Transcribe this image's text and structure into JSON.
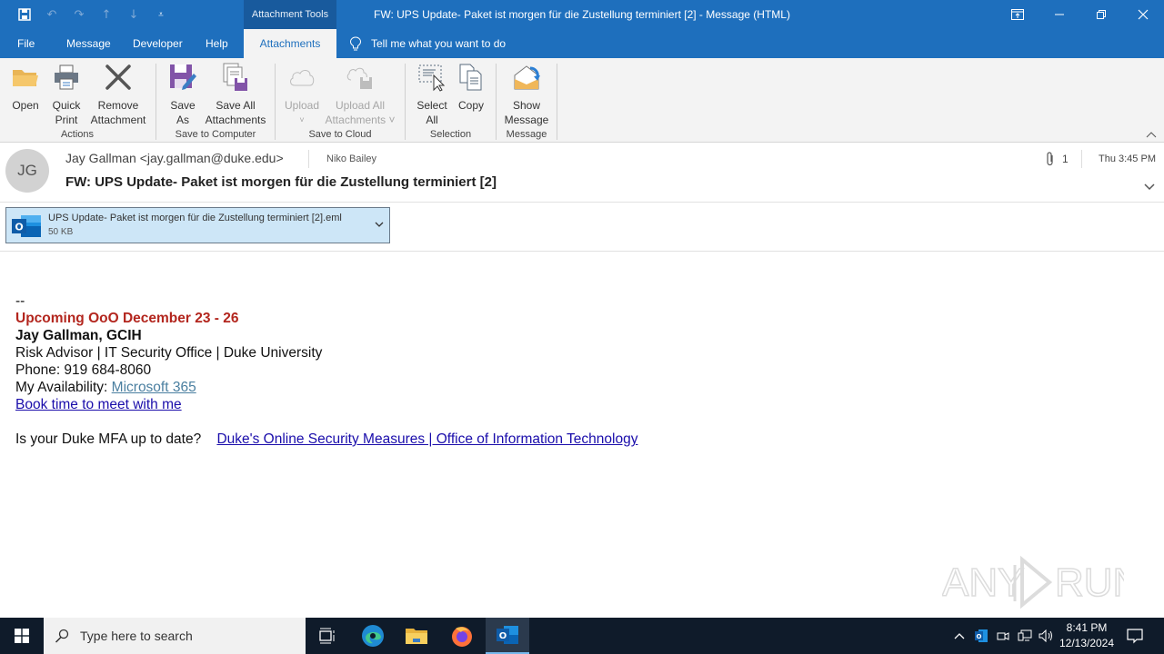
{
  "titlebar": {
    "context_tools": "Attachment Tools",
    "window_title": "FW: UPS Update- Paket ist morgen für die Zustellung terminiert [2]  -  Message (HTML)"
  },
  "tabs": [
    {
      "label": "File"
    },
    {
      "label": "Message"
    },
    {
      "label": "Developer"
    },
    {
      "label": "Help"
    },
    {
      "label": "Attachments",
      "active": true
    }
  ],
  "tell_me": "Tell me what you want to do",
  "ribbon": {
    "groups": [
      {
        "label": "Actions",
        "buttons": [
          {
            "label1": "Open",
            "label2": ""
          },
          {
            "label1": "Quick",
            "label2": "Print"
          },
          {
            "label1": "Remove",
            "label2": "Attachment"
          }
        ]
      },
      {
        "label": "Save to Computer",
        "buttons": [
          {
            "label1": "Save",
            "label2": "As"
          },
          {
            "label1": "Save All",
            "label2": "Attachments"
          }
        ]
      },
      {
        "label": "Save to Cloud",
        "buttons": [
          {
            "label1": "Upload",
            "label2": "˅",
            "disabled": true
          },
          {
            "label1": "Upload All",
            "label2": "Attachments ˅",
            "disabled": true
          }
        ]
      },
      {
        "label": "Selection",
        "buttons": [
          {
            "label1": "Select",
            "label2": "All"
          },
          {
            "label1": "Copy",
            "label2": ""
          }
        ]
      },
      {
        "label": "Message",
        "buttons": [
          {
            "label1": "Show",
            "label2": "Message"
          }
        ]
      }
    ]
  },
  "message": {
    "avatar_initials": "JG",
    "sender": "Jay Gallman <jay.gallman@duke.edu>",
    "recipient": "Niko Bailey",
    "subject": "FW: UPS Update- Paket ist morgen für die Zustellung terminiert [2]",
    "attachment_count": "1",
    "time": "Thu 3:45 PM"
  },
  "attachment": {
    "name": "UPS Update- Paket ist morgen für die Zustellung terminiert [2].eml",
    "size": "50 KB"
  },
  "body": {
    "separator": "--",
    "ooo": "Upcoming OoO December 23 - 26",
    "name": "Jay Gallman, GCIH",
    "title": "Risk Advisor | IT Security Office | Duke University",
    "phone": "Phone: 919 684-8060",
    "availability_label": "My Availability: ",
    "availability_link": "Microsoft 365",
    "book_link": "Book time to meet with me",
    "mfa_question": "Is your Duke MFA up to date?",
    "mfa_link": "Duke's Online Security Measures | Office of Information Technology"
  },
  "watermark": "ANY RUN",
  "taskbar": {
    "search_placeholder": "Type here to search",
    "clock_time": "8:41 PM",
    "clock_date": "12/13/2024"
  },
  "colors": {
    "accent": "#1e6fbd",
    "ooo_red": "#b3261e",
    "link": "#1a0dab",
    "attachment_chip": "#cde6f7",
    "taskbar": "#0f1b2a"
  }
}
